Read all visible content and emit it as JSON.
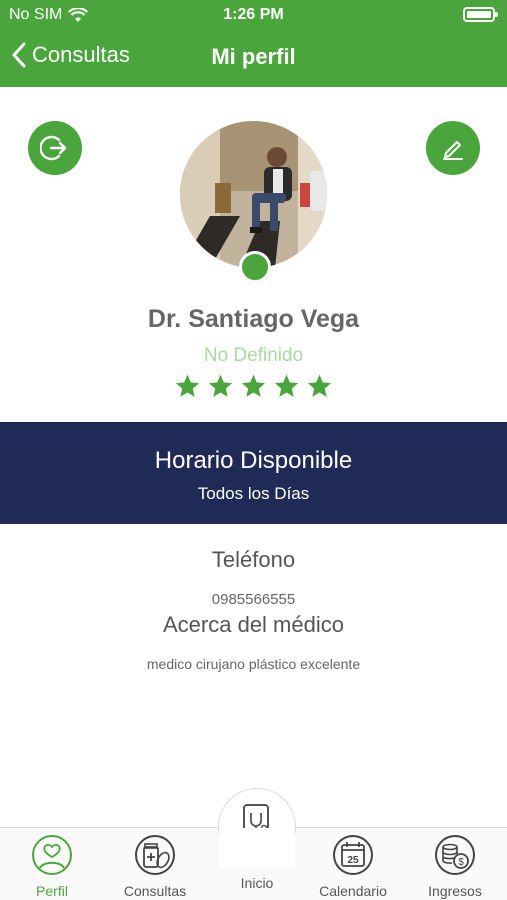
{
  "status_bar": {
    "carrier": "No SIM",
    "time": "1:26 PM"
  },
  "nav": {
    "back_label": "Consultas",
    "title": "Mi perfil"
  },
  "profile": {
    "name": "Dr. Santiago Vega",
    "specialty": "No Definido",
    "rating": 5,
    "rating_max": 5
  },
  "schedule": {
    "heading": "Horario Disponible",
    "value": "Todos los Días"
  },
  "contact": {
    "phone_label": "Teléfono",
    "phone": "0985566555",
    "about_label": "Acerca del médico",
    "about": "medico  cirujano plástico excelente"
  },
  "tabbar": {
    "items": [
      {
        "label": "Perfil",
        "icon": "user-heart-icon"
      },
      {
        "label": "Consultas",
        "icon": "medicine-icon"
      },
      {
        "label": "Inicio",
        "icon": "stethoscope-phone-icon"
      },
      {
        "label": "Calendario",
        "icon": "calendar-icon",
        "badge": "25"
      },
      {
        "label": "Ingresos",
        "icon": "coins-icon"
      }
    ]
  },
  "colors": {
    "primary": "#4aa63c",
    "navy": "#1f2a56",
    "specialty": "#a8d9a0"
  }
}
